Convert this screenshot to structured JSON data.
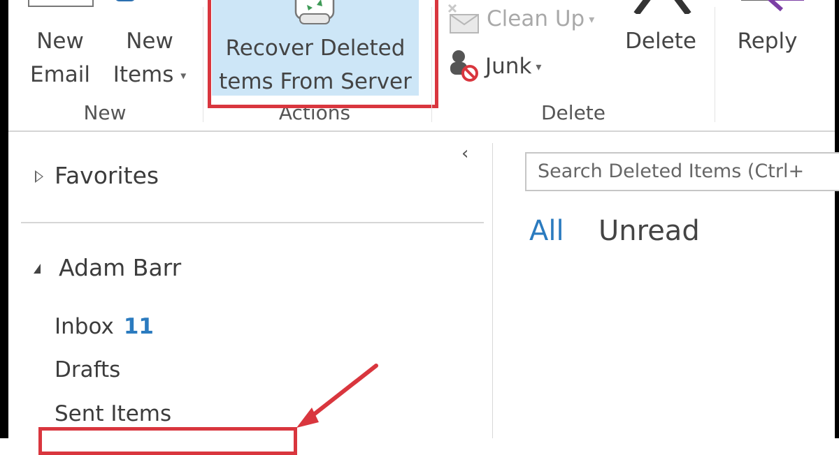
{
  "ribbon": {
    "new_email": [
      "New",
      "Email"
    ],
    "new_items": [
      "New",
      "Items"
    ],
    "new_items_dropdown": "▾",
    "group_new": "New",
    "recover_deleted": [
      "Recover Deleted",
      "tems From Server"
    ],
    "group_actions": "Actions",
    "clean_up": "Clean Up",
    "clean_up_dropdown": "▾",
    "junk": "Junk",
    "junk_dropdown": "▾",
    "delete": "Delete",
    "group_delete": "Delete",
    "reply": "Reply"
  },
  "nav": {
    "collapse_glyph": "‹",
    "favorites": "Favorites",
    "account": "Adam Barr",
    "folders": [
      {
        "label": "Inbox",
        "count": "11"
      },
      {
        "label": "Drafts"
      },
      {
        "label": "Sent Items"
      }
    ]
  },
  "main": {
    "search_placeholder": "Search Deleted Items (Ctrl+",
    "filter_all": "All",
    "filter_unread": "Unread"
  },
  "colors": {
    "accent": "#2b7bbf",
    "highlight_box": "#d9363e",
    "selected_button_bg": "#cde6f7"
  }
}
